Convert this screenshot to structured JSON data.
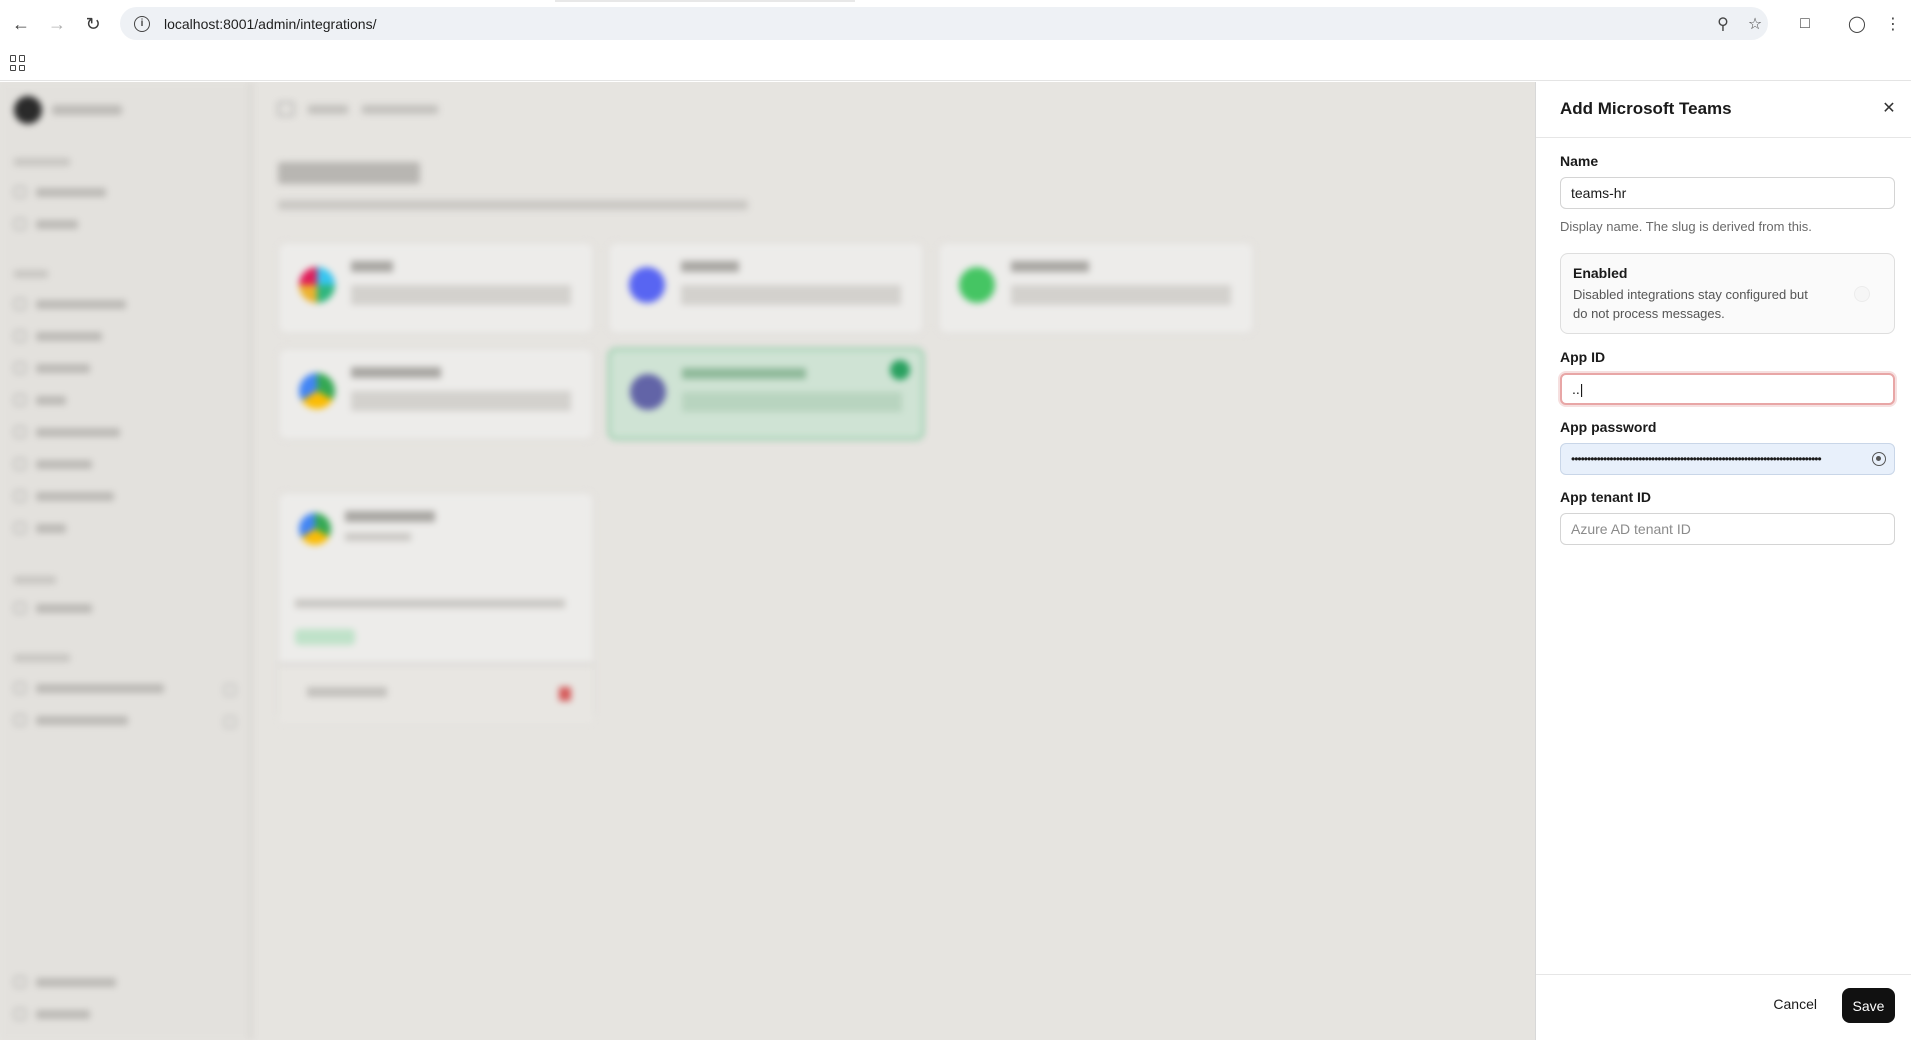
{
  "browser": {
    "url": "localhost:8001/admin/integrations/",
    "icons": [
      "back-icon",
      "forward-icon",
      "reload-icon",
      "site-info-icon",
      "password-key-icon",
      "bookmark-star-icon",
      "extensions-icon",
      "profile-icon",
      "menu-icon",
      "apps-icon"
    ]
  },
  "panel": {
    "title": "Add Microsoft Teams",
    "name_label": "Name",
    "name_value": "teams-hr",
    "name_hint": "Display name. The slug is derived from this.",
    "enabled_title": "Enabled",
    "enabled_desc": "Disabled integrations stay configured but do not process messages.",
    "app_id_label": "App ID",
    "app_id_value": "..|",
    "app_password_label": "App password",
    "app_password_value": "••••••••••••••••••••••••••••••••••••••••••••••••••••••••••••••••••••••••••••••",
    "app_tenant_label": "App tenant ID",
    "app_tenant_placeholder": "Azure AD tenant ID",
    "cancel_label": "Cancel",
    "save_label": "Save"
  },
  "colors": {
    "accent_green": "#2aa160",
    "focus_ring": "#e8a6a6",
    "save_button": "#111111"
  }
}
